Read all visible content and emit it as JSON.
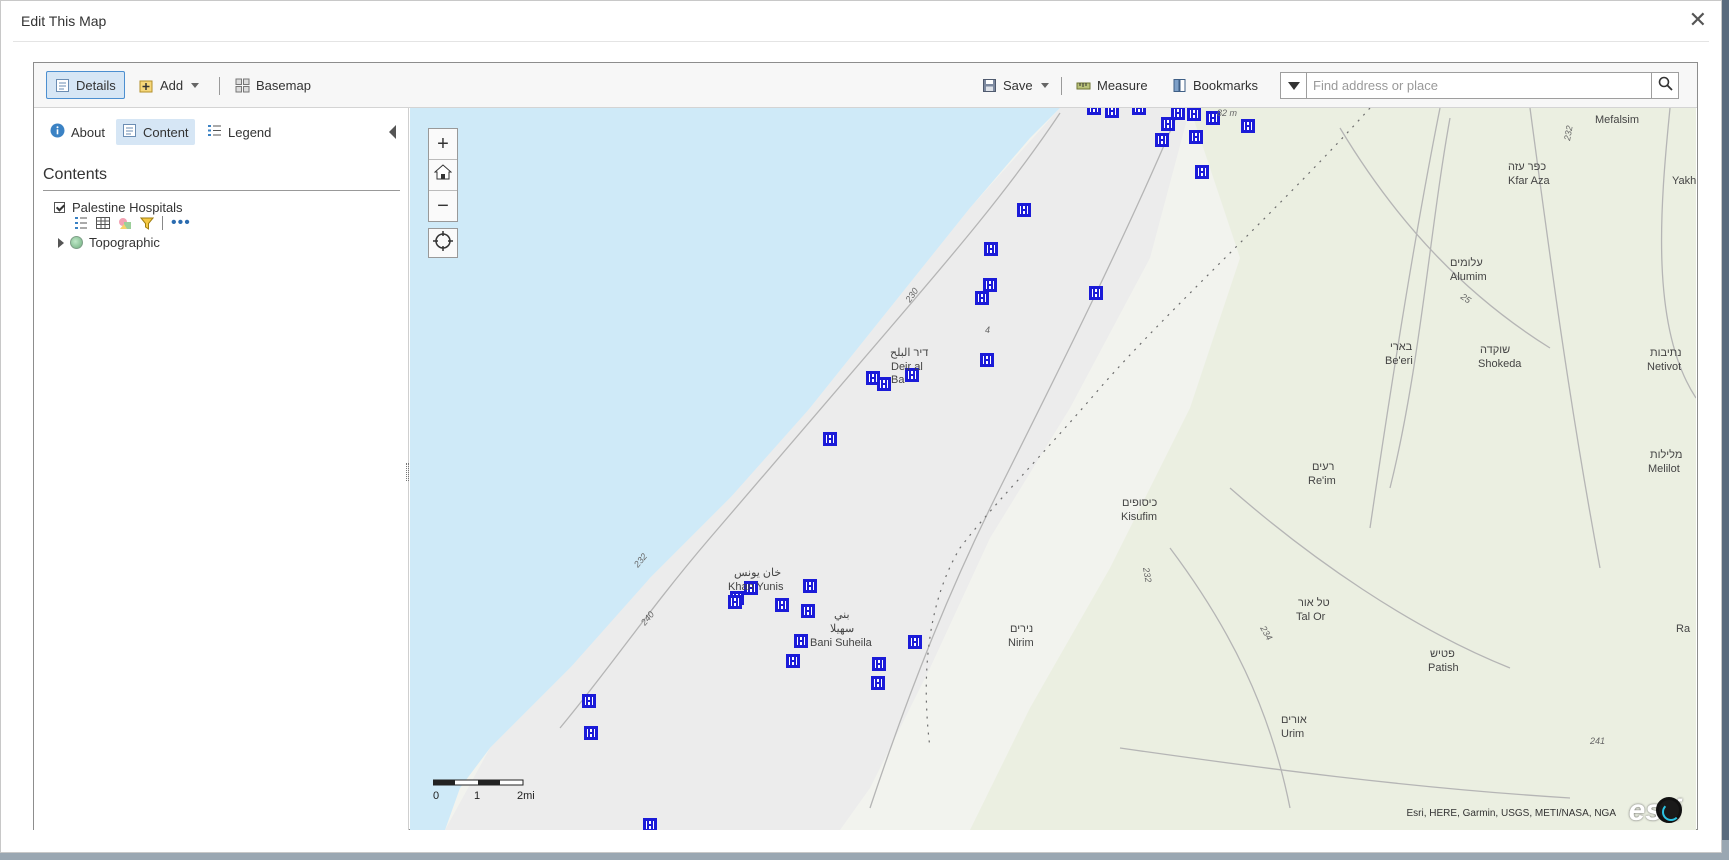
{
  "dialog": {
    "title": "Edit This Map"
  },
  "toolbar": {
    "details_label": "Details",
    "add_label": "Add",
    "basemap_label": "Basemap",
    "save_label": "Save",
    "measure_label": "Measure",
    "bookmarks_label": "Bookmarks"
  },
  "search": {
    "placeholder": "Find address or place"
  },
  "sidebar": {
    "tabs": {
      "about": "About",
      "content": "Content",
      "legend": "Legend"
    },
    "contents_title": "Contents",
    "layers": [
      {
        "label": "Palestine Hospitals",
        "checked": true
      }
    ],
    "basemap_layer": "Topographic"
  },
  "map": {
    "labels": [
      "Mefalsim",
      "כפר עזה",
      "Kfar Aza",
      "עלומים",
      "Alumim",
      "בארי",
      "Be'eri",
      "שוקדה",
      "Shokeda",
      "נתיבות",
      "Netivot",
      "מלילות",
      "Melilot",
      "דיר البلح",
      "Deir al",
      "Ba",
      "רעים",
      "Re'im",
      "כיסופים",
      "Kisufim",
      "خان يونس",
      "Khan Yunis",
      "بني",
      "سهيلا",
      "Bani Suheila",
      "טל אור",
      "Tal Or",
      "נירים",
      "Nirim",
      "פטיש",
      "Patish",
      "אורים",
      "Urim",
      "Yakh",
      "Ra",
      "82 m",
      "232",
      "25",
      "230",
      "240",
      "4",
      "232",
      "234",
      "241",
      "232"
    ],
    "hospital_icon": "hospital-marker",
    "attribution": "Esri, HERE, Garmin, USGS, METI/NASA, NGA",
    "scale": {
      "ticks": [
        "0",
        "1",
        "2mi"
      ]
    },
    "logo": "esri"
  },
  "colors": {
    "water": "#cfeaf8",
    "hospital": "#1b1bd8",
    "accent": "#4c8fd0"
  }
}
